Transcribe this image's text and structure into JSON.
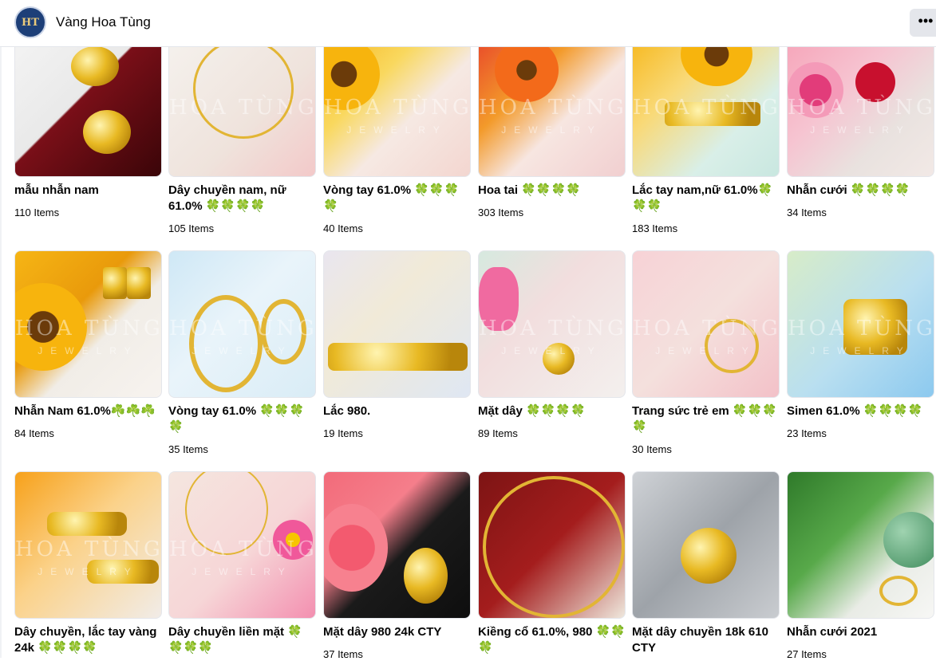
{
  "header": {
    "page_name": "Vàng Hoa Tùng",
    "avatar_text": "HT",
    "more_label": "•••"
  },
  "watermark": {
    "line1": "HOA TÙNG",
    "line2": "JEWELRY"
  },
  "albums": [
    {
      "title": "mẫu nhẫn nam",
      "count": "110 Items"
    },
    {
      "title": "Dây chuyền nam, nữ 61.0% 🍀🍀🍀🍀",
      "count": "105 Items"
    },
    {
      "title": "Vòng tay 61.0% 🍀🍀🍀🍀",
      "count": "40 Items"
    },
    {
      "title": "Hoa tai 🍀🍀🍀🍀",
      "count": "303 Items"
    },
    {
      "title": "Lắc tay nam,nữ 61.0%🍀🍀🍀",
      "count": "183 Items"
    },
    {
      "title": "Nhẫn cưới 🍀🍀🍀🍀",
      "count": "34 Items"
    },
    {
      "title": "Nhẫn Nam 61.0%☘️☘️☘️",
      "count": "84 Items"
    },
    {
      "title": "Vòng tay 61.0% 🍀🍀🍀🍀",
      "count": "35 Items"
    },
    {
      "title": "Lắc 980.",
      "count": "19 Items"
    },
    {
      "title": "Mặt dây 🍀🍀🍀🍀",
      "count": "89 Items"
    },
    {
      "title": "Trang sức trẻ em 🍀🍀🍀🍀",
      "count": "30 Items"
    },
    {
      "title": "Simen 61.0% 🍀🍀🍀🍀",
      "count": "23 Items"
    },
    {
      "title": "Dây chuyền, lắc tay vàng 24k 🍀🍀🍀🍀",
      "count": ""
    },
    {
      "title": "Dây chuyền liền mặt 🍀🍀🍀🍀",
      "count": ""
    },
    {
      "title": "Mặt dây 980 24k CTY",
      "count": "37 Items"
    },
    {
      "title": "Kiềng cổ 61.0%, 980 🍀🍀🍀",
      "count": ""
    },
    {
      "title": "Mặt dây chuyền 18k 610 CTY",
      "count": ""
    },
    {
      "title": "Nhẫn cưới 2021",
      "count": "27 Items"
    }
  ],
  "thumb_styles": [
    {
      "bg": "linear-gradient(135deg,#f4f4f4 0%,#e9e9e9 45%,#7a0f18 46%,#3a0508 100%)"
    },
    {
      "bg": "linear-gradient(135deg,#f5f2ee 0%,#efe3dc 60%,#f3c9c9 100%)"
    },
    {
      "bg": "linear-gradient(135deg,#f7b21a 0%,#f9d85e 35%,#f6e9e3 60%,#f3d6d0 100%)"
    },
    {
      "bg": "linear-gradient(135deg,#e8432a 0%,#f39a2a 35%,#f7e6e1 60%,#f1cfd0 100%)"
    },
    {
      "bg": "linear-gradient(135deg,#f6b618 0%,#f9d977 35%,#d9efe8 70%,#c9e7e0 100%)"
    },
    {
      "bg": "linear-gradient(135deg,#f6a3b8 0%,#f6c4d1 40%,#e9e2df 70%,#f2e9e6 100%)"
    },
    {
      "bg": "linear-gradient(135deg,#f6b515 0%,#e99a0b 40%,#f1ede7 60%,#f7f3ef 100%)"
    },
    {
      "bg": "linear-gradient(135deg,#cfe8f6 0%,#e9f4fa 45%,#d9ecf6 100%)"
    },
    {
      "bg": "linear-gradient(135deg,#e9e6ef 0%,#f1ead8 40%,#dfe7f3 100%)"
    },
    {
      "bg": "linear-gradient(135deg,#d6e9df 0%,#f2dede 40%,#f3f0ee 100%)"
    },
    {
      "bg": "linear-gradient(135deg,#f7d2d6 0%,#f4e0dd 50%,#f3c1c8 100%)"
    },
    {
      "bg": "linear-gradient(135deg,#d7ecc8 0%,#b9dff0 55%,#8cc9ef 100%)"
    },
    {
      "bg": "linear-gradient(135deg,#f7a11a 0%,#fbd28a 45%,#f1ece8 100%)"
    },
    {
      "bg": "linear-gradient(135deg,#f5e6df 0%,#f6d6d7 55%,#f38fb0 100%)"
    },
    {
      "bg": "linear-gradient(135deg,#f26b7a 0%,#f57e8b 35%,#1a1a1a 55%,#0e0e0e 100%)"
    },
    {
      "bg": "linear-gradient(135deg,#7d1414 0%,#a41d1d 50%,#efe8dd 100%)"
    },
    {
      "bg": "linear-gradient(135deg,#cfd2d6 0%,#9ea3a9 50%,#c9ccd0 100%)"
    },
    {
      "bg": "linear-gradient(135deg,#2f7a2a 0%,#58a94a 40%,#e9ece6 70%,#f7f7f5 100%)"
    }
  ]
}
